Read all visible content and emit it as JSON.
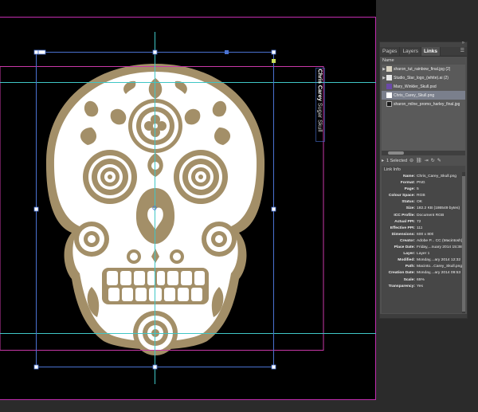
{
  "panel": {
    "tabs": [
      {
        "label": "Pages",
        "active": false
      },
      {
        "label": "Layers",
        "active": false
      },
      {
        "label": "Links",
        "active": true
      }
    ],
    "menu_icon": "panel-menu-icon",
    "column_header": "Name",
    "links": [
      {
        "name": "sharon_tut_rainbow_final.jpg (2)",
        "expand": "▶",
        "selected": false,
        "thumb": "#d9d3c2"
      },
      {
        "name": "Studio_Star_logo_(white).ai (2)",
        "expand": "▶",
        "selected": false,
        "thumb": "#e9e9e9"
      },
      {
        "name": "Mary_Winkler_Skull.psd",
        "expand": "",
        "selected": false,
        "thumb": "#6b4aa8"
      },
      {
        "name": "Chris_Carey_Skull.png",
        "expand": "",
        "selected": true,
        "thumb": "#ffffff"
      },
      {
        "name": "sharon_milne_promo_harley_final.jpg",
        "expand": "",
        "selected": false,
        "thumb": "#1b1b1b"
      }
    ],
    "status": {
      "selected_text": "1 Selected"
    },
    "link_info_title": "Link Info",
    "link_info": [
      {
        "label": "Name:",
        "value": "Chris_Carey_Skull.png"
      },
      {
        "label": "Format:",
        "value": "PNG"
      },
      {
        "label": "Page:",
        "value": "5"
      },
      {
        "label": "Colour Space:",
        "value": "RGB"
      },
      {
        "label": "Status:",
        "value": "OK"
      },
      {
        "label": "Size:",
        "value": "182.2 KB (186549 bytes)"
      },
      {
        "label": "ICC Profile:",
        "value": "Document RGB"
      },
      {
        "label": "Actual PPI:",
        "value": "72"
      },
      {
        "label": "Effective PPI:",
        "value": "111"
      },
      {
        "label": "Dimensions:",
        "value": "600 x 800"
      },
      {
        "label": "Creator:",
        "value": "Adobe P... CC (Macintosh)"
      },
      {
        "label": "Place Date:",
        "value": "Friday,...nuary 2014 15:38"
      },
      {
        "label": "Layer:",
        "value": "Layer 1"
      },
      {
        "label": "Modified:",
        "value": "Monday,...ary 2014 12:32"
      },
      {
        "label": "Path:",
        "value": "Macinto...Carey_Skull.png"
      },
      {
        "label": "Creation Date:",
        "value": "Monday,...ary 2014 09:53"
      },
      {
        "label": "Scale:",
        "value": "65%"
      },
      {
        "label": "Transparency:",
        "value": "Yes"
      }
    ]
  },
  "canvas": {
    "caption_bold": "Chris Carey",
    "caption_light": " Sugar Skull"
  },
  "colors": {
    "skull_gold": "#a38f68",
    "skull_white": "#ffffff",
    "page_bg": "#000000",
    "pasteboard": "#2b2b2b",
    "frame_blue": "#4a72d1",
    "margin_magenta": "#c838a8",
    "guide_cyan": "#3fc6c6"
  }
}
